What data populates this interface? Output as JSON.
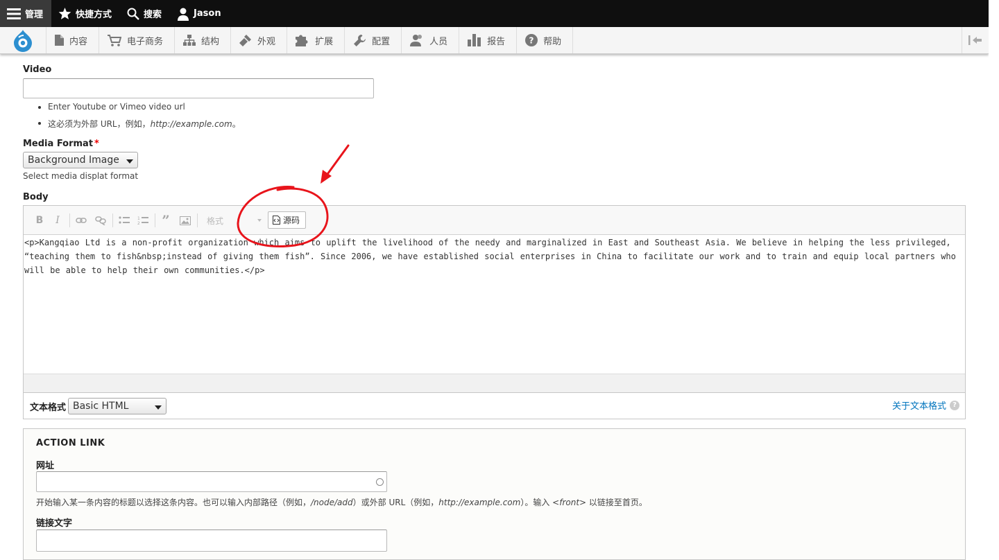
{
  "toolbar": {
    "manage_label": "管理",
    "shortcuts_label": "快捷方式",
    "search_label": "搜索",
    "user_label": "Jason"
  },
  "menu": {
    "items": [
      {
        "label": "内容",
        "icon": "file-icon"
      },
      {
        "label": "电子商务",
        "icon": "cart-icon"
      },
      {
        "label": "结构",
        "icon": "sitemap-icon"
      },
      {
        "label": "外观",
        "icon": "paintbrush-icon"
      },
      {
        "label": "扩展",
        "icon": "puzzle-icon"
      },
      {
        "label": "配置",
        "icon": "wrench-icon"
      },
      {
        "label": "人员",
        "icon": "people-icon"
      },
      {
        "label": "报告",
        "icon": "bar-chart-icon"
      },
      {
        "label": "帮助",
        "icon": "help-icon"
      }
    ]
  },
  "video": {
    "label": "Video",
    "value": "",
    "desc_1": "Enter Youtube or Vimeo video url",
    "desc_2_prefix": "这必须为外部 URL，例如，",
    "desc_2_example": "http://example.com",
    "desc_2_suffix": "。"
  },
  "media_format": {
    "label": "Media Format",
    "required_mark": "*",
    "value": "Background Image",
    "desc": "Select media displat format"
  },
  "body": {
    "label": "Body",
    "format_placeholder": "格式",
    "source_label": "源码",
    "source_code": "<p>Kangqiao Ltd is a non-profit organization which aims to uplift the livelihood of the needy and marginalized in East and Southeast Asia. We believe in helping the less privileged, “teaching them to fish&nbsp;instead of giving them fish”. Since 2006, we have established social enterprises in China to facilitate our work and to train and equip local partners who will be able to help their own communities.</p>",
    "text_format_label": "文本格式",
    "text_format_value": "Basic HTML",
    "about_formats_link": "关于文本格式",
    "help_glyph": "?"
  },
  "action_link": {
    "legend": "ACTION LINK",
    "url_label": "网址",
    "url_value": "",
    "url_desc_1": "开始输入某一条内容的标题以选择这条内容。也可以输入内部路径（例如，",
    "url_desc_node": "/node/add",
    "url_desc_2": "）或外部 URL（例如，",
    "url_desc_example": "http://example.com",
    "url_desc_3": "）。输入 ",
    "url_desc_front": "<front>",
    "url_desc_4": " 以链接至首页。",
    "link_text_label": "链接文字",
    "link_text_value": ""
  },
  "colors": {
    "annotation": "#e8141b",
    "link": "#0074bd",
    "drupal_blue": "#2c8fd0"
  }
}
